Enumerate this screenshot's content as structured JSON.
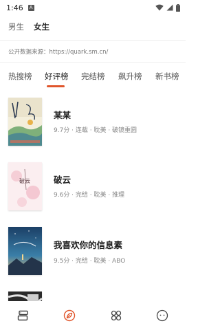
{
  "status_bar": {
    "time": "1:46",
    "notification_letter": "A"
  },
  "gender_tabs": {
    "male": "男生",
    "female": "女生"
  },
  "source": {
    "text": "公开数据来源：https://quark.sm.cn/"
  },
  "rank_tabs": [
    {
      "label": "热搜榜"
    },
    {
      "label": "好评榜"
    },
    {
      "label": "完结榜"
    },
    {
      "label": "飙升榜"
    },
    {
      "label": "新书榜"
    }
  ],
  "active_tab_index": 1,
  "books": [
    {
      "title": "某某",
      "meta": "9.7分 · 连载 · 耽美 · 破镜重圆",
      "cover_text": "某某"
    },
    {
      "title": "破云",
      "meta": "9.6分 · 完结 · 耽美 · 推理",
      "cover_text": "破云"
    },
    {
      "title": "我喜欢你的信息素",
      "meta": "9.5分 · 完结 · 耽美 · ABO",
      "cover_text": ""
    },
    {
      "title": "",
      "meta": "",
      "cover_text": ""
    }
  ],
  "colors": {
    "accent": "#e0552b",
    "text_primary": "#222222",
    "text_secondary": "#888888"
  },
  "bottom_nav": [
    {
      "icon": "bookshelf-icon"
    },
    {
      "icon": "discover-leaf-icon"
    },
    {
      "icon": "category-grid-icon"
    },
    {
      "icon": "profile-face-icon"
    }
  ]
}
